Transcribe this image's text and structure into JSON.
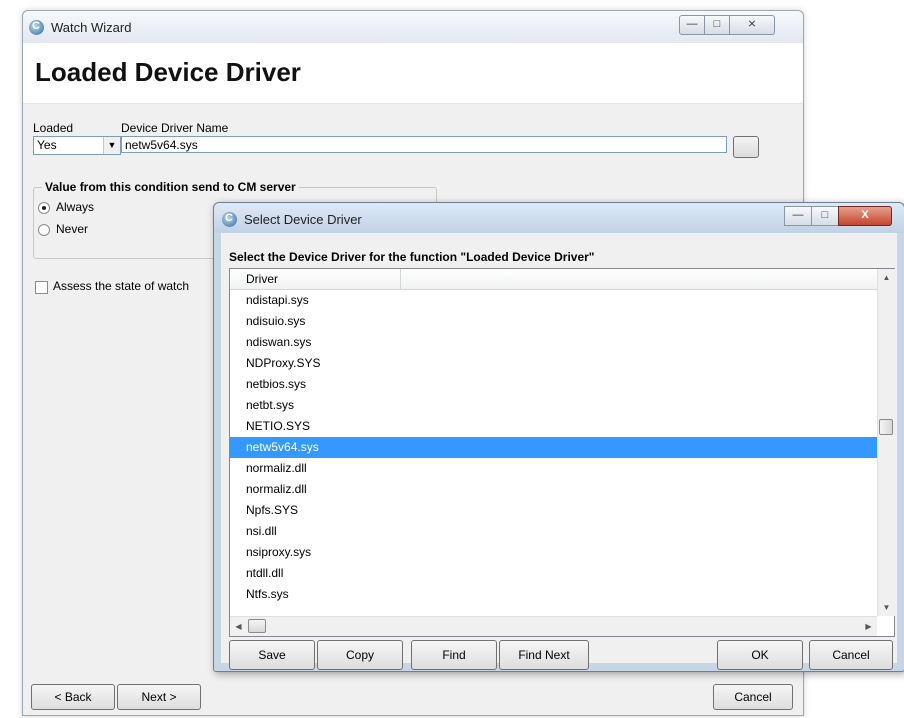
{
  "main_window": {
    "title": "Watch Wizard",
    "caption_buttons": {
      "minimize": "—",
      "maximize": "□",
      "close": "⨯"
    },
    "page_title": "Loaded Device Driver",
    "loaded_label": "Loaded",
    "loaded_value": "Yes",
    "device_driver_label": "Device Driver Name",
    "device_driver_value": "netw5v64.sys",
    "value_group_title": "Value from this condition send to CM server",
    "radio_always": "Always",
    "radio_never": "Never",
    "assess_label": "Assess the state of watch",
    "back_label": "< Back",
    "next_label": "Next >",
    "cancel_label": "Cancel"
  },
  "dialog": {
    "title": "Select Device Driver",
    "caption_buttons": {
      "minimize": "—",
      "maximize": "□",
      "close": "X"
    },
    "heading": "Select the Device Driver for the function \"Loaded Device Driver\"",
    "column_header": "Driver",
    "rows": [
      "ndistapi.sys",
      "ndisuio.sys",
      "ndiswan.sys",
      "NDProxy.SYS",
      "netbios.sys",
      "netbt.sys",
      "NETIO.SYS",
      "netw5v64.sys",
      "normaliz.dll",
      "normaliz.dll",
      "Npfs.SYS",
      "nsi.dll",
      "nsiproxy.sys",
      "ntdll.dll",
      "Ntfs.sys"
    ],
    "selected_index": 7,
    "scroll_glyphs": {
      "up": "▲",
      "down": "▼",
      "left": "◀",
      "right": "▶"
    },
    "buttons": {
      "save": "Save",
      "copy": "Copy",
      "find": "Find",
      "find_next": "Find Next",
      "ok": "OK",
      "cancel": "Cancel"
    }
  },
  "colors": {
    "selection": "#3399ff",
    "close_button": "#c4462e",
    "dialog_frame": "#c7d6e6"
  }
}
